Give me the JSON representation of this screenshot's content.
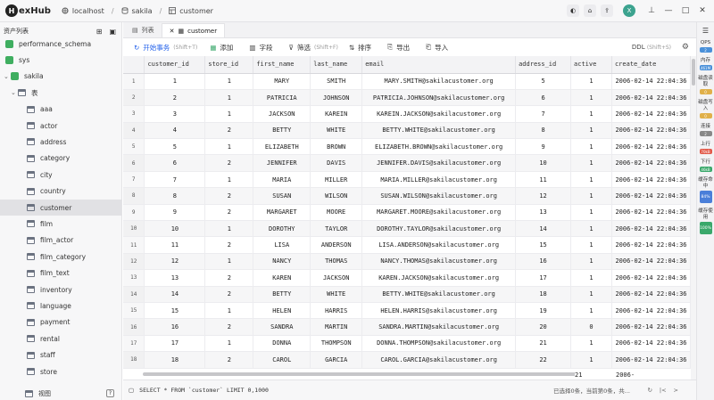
{
  "app": {
    "name": "HexHub",
    "logo_letter": "H",
    "logo_rest": "exHub"
  },
  "breadcrumb": [
    "localhost",
    "sakila",
    "customer"
  ],
  "top_buttons": {
    "avatar": "X"
  },
  "sidebar": {
    "title": "资产列表",
    "items": [
      {
        "label": "performance_schema",
        "type": "db"
      },
      {
        "label": "sys",
        "type": "db"
      },
      {
        "label": "sakila",
        "type": "db",
        "expanded": true
      },
      {
        "label": "表",
        "type": "folder"
      },
      {
        "label": "aaa",
        "type": "table"
      },
      {
        "label": "actor",
        "type": "table"
      },
      {
        "label": "address",
        "type": "table"
      },
      {
        "label": "category",
        "type": "table"
      },
      {
        "label": "city",
        "type": "table"
      },
      {
        "label": "country",
        "type": "table"
      },
      {
        "label": "customer",
        "type": "table",
        "selected": true
      },
      {
        "label": "film",
        "type": "table"
      },
      {
        "label": "film_actor",
        "type": "table"
      },
      {
        "label": "film_category",
        "type": "table"
      },
      {
        "label": "film_text",
        "type": "table"
      },
      {
        "label": "inventory",
        "type": "table"
      },
      {
        "label": "language",
        "type": "table"
      },
      {
        "label": "payment",
        "type": "table"
      },
      {
        "label": "rental",
        "type": "table"
      },
      {
        "label": "staff",
        "type": "table"
      },
      {
        "label": "store",
        "type": "table"
      }
    ],
    "footer": "视图",
    "help": "?"
  },
  "tabs": [
    {
      "label": "列表"
    },
    {
      "label": "customer",
      "active": true
    }
  ],
  "toolbar": {
    "begin_tx": "开始事务",
    "begin_tx_hint": "(Shift+T)",
    "add": "添加",
    "fields": "字段",
    "filter": "筛选",
    "filter_hint": "(Shift+F)",
    "sort": "排序",
    "export": "导出",
    "import": "导入",
    "ddl": "DDL",
    "ddl_hint": "(Shift+S)"
  },
  "grid": {
    "columns": [
      "customer_id",
      "store_id",
      "first_name",
      "last_name",
      "email",
      "address_id",
      "active",
      "create_date"
    ],
    "rows": [
      [
        "1",
        "1",
        "1",
        "MARY",
        "SMITH",
        "MARY.SMITH@sakilacustomer.org",
        "5",
        "1",
        "2006-02-14 22:04:36"
      ],
      [
        "2",
        "2",
        "1",
        "PATRICIA",
        "JOHNSON",
        "PATRICIA.JOHNSON@sakilacustomer.org",
        "6",
        "1",
        "2006-02-14 22:04:36"
      ],
      [
        "3",
        "3",
        "1",
        "JACKSON",
        "KAREIN",
        "KAREIN.JACKSON@sakilacustomer.org",
        "7",
        "1",
        "2006-02-14 22:04:36"
      ],
      [
        "4",
        "4",
        "2",
        "BETTY",
        "WHITE",
        "BETTY.WHITE@sakilacustomer.org",
        "8",
        "1",
        "2006-02-14 22:04:36"
      ],
      [
        "5",
        "5",
        "1",
        "ELIZABETH",
        "BROWN",
        "ELIZABETH.BROWN@sakilacustomer.org",
        "9",
        "1",
        "2006-02-14 22:04:36"
      ],
      [
        "6",
        "6",
        "2",
        "JENNIFER",
        "DAVIS",
        "JENNIFER.DAVIS@sakilacustomer.org",
        "10",
        "1",
        "2006-02-14 22:04:36"
      ],
      [
        "7",
        "7",
        "1",
        "MARIA",
        "MILLER",
        "MARIA.MILLER@sakilacustomer.org",
        "11",
        "1",
        "2006-02-14 22:04:36"
      ],
      [
        "8",
        "8",
        "2",
        "SUSAN",
        "WILSON",
        "SUSAN.WILSON@sakilacustomer.org",
        "12",
        "1",
        "2006-02-14 22:04:36"
      ],
      [
        "9",
        "9",
        "2",
        "MARGARET",
        "MOORE",
        "MARGARET.MOORE@sakilacustomer.org",
        "13",
        "1",
        "2006-02-14 22:04:36"
      ],
      [
        "10",
        "10",
        "1",
        "DOROTHY",
        "TAYLOR",
        "DOROTHY.TAYLOR@sakilacustomer.org",
        "14",
        "1",
        "2006-02-14 22:04:36"
      ],
      [
        "11",
        "11",
        "2",
        "LISA",
        "ANDERSON",
        "LISA.ANDERSON@sakilacustomer.org",
        "15",
        "1",
        "2006-02-14 22:04:36"
      ],
      [
        "12",
        "12",
        "1",
        "NANCY",
        "THOMAS",
        "NANCY.THOMAS@sakilacustomer.org",
        "16",
        "1",
        "2006-02-14 22:04:36"
      ],
      [
        "13",
        "13",
        "2",
        "KAREN",
        "JACKSON",
        "KAREN.JACKSON@sakilacustomer.org",
        "17",
        "1",
        "2006-02-14 22:04:36"
      ],
      [
        "14",
        "14",
        "2",
        "BETTY",
        "WHITE",
        "BETTY.WHITE@sakilacustomer.org",
        "18",
        "1",
        "2006-02-14 22:04:36"
      ],
      [
        "15",
        "15",
        "1",
        "HELEN",
        "HARRIS",
        "HELEN.HARRIS@sakilacustomer.org",
        "19",
        "1",
        "2006-02-14 22:04:36"
      ],
      [
        "16",
        "16",
        "2",
        "SANDRA",
        "MARTIN",
        "SANDRA.MARTIN@sakilacustomer.org",
        "20",
        "0",
        "2006-02-14 22:04:36"
      ],
      [
        "17",
        "17",
        "1",
        "DONNA",
        "THOMPSON",
        "DONNA.THOMPSON@sakilacustomer.org",
        "21",
        "1",
        "2006-02-14 22:04:36"
      ],
      [
        "18",
        "18",
        "2",
        "CAROL",
        "GARCIA",
        "CAROL.GARCIA@sakilacustomer.org",
        "22",
        "1",
        "2006-02-14 22:04:36"
      ]
    ],
    "partial_row_address": "21",
    "partial_row_date": "2006-"
  },
  "status": {
    "sql": "SELECT * FROM `customer` LIMIT 0,1000",
    "info": "已选择0条，当前第0条，共..."
  },
  "metrics": [
    {
      "label": "QPS",
      "value": "2",
      "color": "#4a90d9"
    },
    {
      "label": "内存",
      "value": "461M",
      "color": "#4a90d9"
    },
    {
      "label": "磁盘读取",
      "value": "0",
      "color": "#e0b04a"
    },
    {
      "label": "磁盘写入",
      "value": "0",
      "color": "#e0b04a"
    },
    {
      "label": "连接",
      "value": "2",
      "color": "#888888"
    },
    {
      "label": "上行",
      "value": "70kB",
      "color": "#e25a4a"
    },
    {
      "label": "下行",
      "value": "46kB",
      "color": "#3aa86b"
    },
    {
      "label": "缓存命中",
      "value": "84%",
      "color": "#4a7fd9"
    },
    {
      "label": "缓存使用",
      "value": "100%",
      "color": "#3aa86b"
    }
  ]
}
